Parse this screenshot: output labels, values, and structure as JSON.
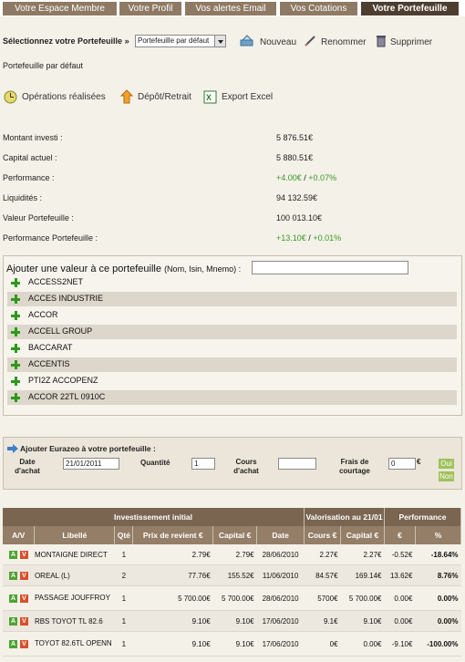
{
  "tabs": [
    "Votre Espace Membre",
    "Votre Profil",
    "Vos alertes Email",
    "Vos Cotations",
    "Votre Portefeuille"
  ],
  "selector": {
    "label": "Sélectionnez votre Portefeuille",
    "arrow": "»",
    "value": "Portefeuille par défaut",
    "actions": {
      "new": "Nouveau",
      "rename": "Renommer",
      "delete": "Supprimer"
    }
  },
  "portfolio_name": "Portefeuille par défaut",
  "links": {
    "operations": "Opérations réalisées",
    "deposit": "Dépôt/Retrait",
    "export": "Export Excel"
  },
  "stats": [
    {
      "label": "Montant investi :",
      "value": "5 876.51€"
    },
    {
      "label": "Capital actuel :",
      "value": "5 880.51€"
    },
    {
      "label": "Performance :",
      "value": "+4.00€",
      "sep": " / ",
      "value2": "+0.07%"
    },
    {
      "label": "Liquidités :",
      "value": "94 132.59€"
    },
    {
      "label": "Valeur Portefeuille :",
      "value": "100 013.10€"
    },
    {
      "label": "Performance Portefeuille :",
      "value": "+13.10€",
      "sep": " / ",
      "value2": "+0.01%"
    }
  ],
  "add_value": {
    "title": "Ajouter une valeur à ce portefeuille",
    "hint": "(Nom, Isin, Mnemo) :",
    "suggestions": [
      "ACCESS2NET",
      "ACCES INDUSTRIE",
      "ACCOR",
      "ACCELL GROUP",
      "BACCARAT",
      "ACCENTIS",
      "PTI2Z ACCOPENZ",
      "ACCOR 22TL 0910C"
    ]
  },
  "add_eurazeo": {
    "title": "Ajouter Eurazeo à votre portefeuille :",
    "date_label": "Date d'achat",
    "date_value": "21/01/2011",
    "qty_label": "Quantité",
    "qty_value": "1",
    "price_label": "Cours d'achat",
    "price_value": "",
    "fees_label": "Frais de courtage",
    "fees_value": "0",
    "fees_unit": "€",
    "ok": "Oui",
    "no": "Non"
  },
  "table": {
    "group_headers": {
      "initial": "Investissement initial",
      "valuation": "Valorisation au 21/01",
      "performance": "Performance"
    },
    "headers": [
      "A/V",
      "Libellé",
      "Qté",
      "Prix de revient €",
      "Capital €",
      "Date",
      "Cours €",
      "Capital €",
      "€",
      "%"
    ],
    "buy": "A",
    "sell": "V",
    "rows": [
      {
        "name": "MONTAIGNE DIRECT",
        "qty": "1",
        "cost": "2.79€",
        "capital": "2.79€",
        "date": "28/06/2010",
        "price": "2.27€",
        "cur_capital": "2.27€",
        "perf_eur": "-0.52€",
        "perf_pct": "-18.64%",
        "trend": "neg"
      },
      {
        "name": "OREAL (L)",
        "qty": "2",
        "cost": "77.76€",
        "capital": "155.52€",
        "date": "11/06/2010",
        "price": "84.57€",
        "cur_capital": "169.14€",
        "perf_eur": "13.62€",
        "perf_pct": "8.76%",
        "trend": "pos"
      },
      {
        "name": "PASSAGE JOUFFROY",
        "qty": "1",
        "cost": "5 700.00€",
        "capital": "5 700.00€",
        "date": "28/06/2010",
        "price": "5700€",
        "cur_capital": "5 700.00€",
        "perf_eur": "0.00€",
        "perf_pct": "0.00%",
        "trend": "zero"
      },
      {
        "name": "RBS TOYOT TL 82.6",
        "qty": "1",
        "cost": "9.10€",
        "capital": "9.10€",
        "date": "17/06/2010",
        "price": "9.1€",
        "cur_capital": "9.10€",
        "perf_eur": "0.00€",
        "perf_pct": "0.00%",
        "trend": "zero"
      },
      {
        "name": "TOYOT 82.6TL OPENN",
        "qty": "1",
        "cost": "9.10€",
        "capital": "9.10€",
        "date": "17/06/2010",
        "price": "0€",
        "cur_capital": "0.00€",
        "perf_eur": "-9.10€",
        "perf_pct": "-100.00%",
        "trend": "neg"
      }
    ]
  },
  "colors": {
    "tab": "#8e7a64",
    "tab_active": "#4e3e30",
    "header": "#7a6551",
    "positive": "#3a9a22",
    "negative": "#d40000",
    "neutral": "#2249c9"
  }
}
